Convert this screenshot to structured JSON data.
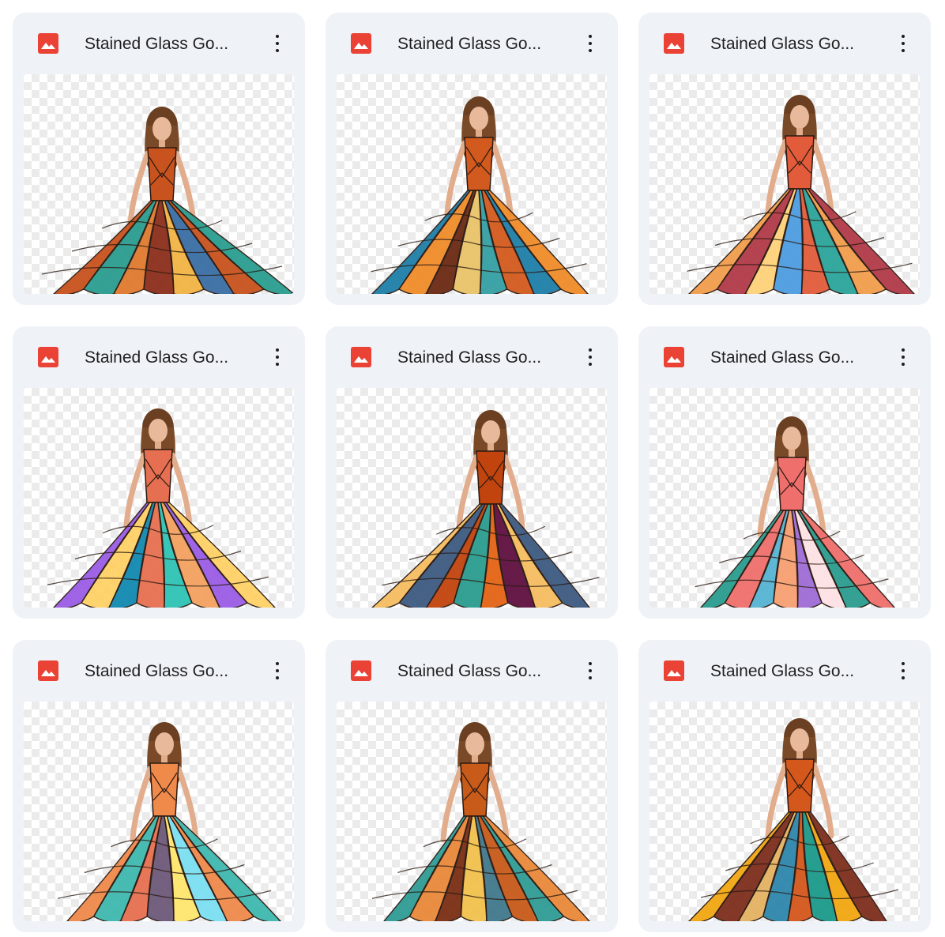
{
  "files": [
    {
      "title": "Stained Glass Go...",
      "icon": "image-file-icon",
      "variant": 0
    },
    {
      "title": "Stained Glass Go...",
      "icon": "image-file-icon",
      "variant": 1
    },
    {
      "title": "Stained Glass Go...",
      "icon": "image-file-icon",
      "variant": 2
    },
    {
      "title": "Stained Glass Go...",
      "icon": "image-file-icon",
      "variant": 3
    },
    {
      "title": "Stained Glass Go...",
      "icon": "image-file-icon",
      "variant": 4
    },
    {
      "title": "Stained Glass Go...",
      "icon": "image-file-icon",
      "variant": 5
    },
    {
      "title": "Stained Glass Go...",
      "icon": "image-file-icon",
      "variant": 6
    },
    {
      "title": "Stained Glass Go...",
      "icon": "image-file-icon",
      "variant": 7
    },
    {
      "title": "Stained Glass Go...",
      "icon": "image-file-icon",
      "variant": 8
    }
  ],
  "colors": {
    "card_bg": "#eff3f8",
    "icon_red": "#ea4335",
    "text": "#1f1f1f"
  }
}
